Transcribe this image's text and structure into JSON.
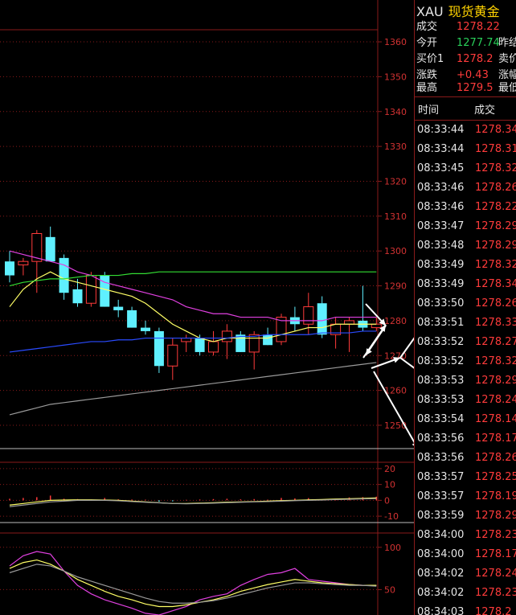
{
  "quote": {
    "code": "XAU",
    "name": "现货黄金",
    "rows": [
      {
        "label": "成交",
        "value": "1278.22",
        "color": "red"
      },
      {
        "label": "今开",
        "value": "1277.74",
        "color": "green",
        "label2": "昨结"
      },
      {
        "label": "买价1",
        "value": "1278.2",
        "color": "red",
        "label2": "卖价"
      },
      {
        "label": "涨跌",
        "value": "+0.43",
        "color": "red",
        "label2": "涨幅"
      },
      {
        "label": "最高",
        "value": "1279.5",
        "color": "red",
        "label2": "最低"
      }
    ]
  },
  "ticks": {
    "headers": [
      "时间",
      "成交"
    ],
    "rows": [
      {
        "time": "08:33:44",
        "price": "1278.34"
      },
      {
        "time": "08:33:44",
        "price": "1278.31"
      },
      {
        "time": "08:33:45",
        "price": "1278.32"
      },
      {
        "time": "08:33:46",
        "price": "1278.26"
      },
      {
        "time": "08:33:46",
        "price": "1278.22"
      },
      {
        "time": "08:33:47",
        "price": "1278.29"
      },
      {
        "time": "08:33:48",
        "price": "1278.29"
      },
      {
        "time": "08:33:49",
        "price": "1278.32"
      },
      {
        "time": "08:33:49",
        "price": "1278.34"
      },
      {
        "time": "08:33:50",
        "price": "1278.26"
      },
      {
        "time": "08:33:51",
        "price": "1278.33"
      },
      {
        "time": "08:33:52",
        "price": "1278.27"
      },
      {
        "time": "08:33:52",
        "price": "1278.32"
      },
      {
        "time": "08:33:53",
        "price": "1278.29"
      },
      {
        "time": "08:33:53",
        "price": "1278.24"
      },
      {
        "time": "08:33:54",
        "price": "1278.14"
      },
      {
        "time": "08:33:56",
        "price": "1278.17"
      },
      {
        "time": "08:33:56",
        "price": "1278.26"
      },
      {
        "time": "08:33:57",
        "price": "1278.25"
      },
      {
        "time": "08:33:57",
        "price": "1278.19"
      },
      {
        "time": "08:33:59",
        "price": "1278.29"
      },
      {
        "time": "08:34:00",
        "price": "1278.23"
      },
      {
        "time": "08:34:00",
        "price": "1278.17"
      },
      {
        "time": "08:34:02",
        "price": "1278.24"
      },
      {
        "time": "08:34:02",
        "price": "1278.23"
      },
      {
        "time": "08:34:03",
        "price": "1278.2"
      }
    ]
  },
  "colors": {
    "up": "#ff3b3b",
    "down": "#5ff0ff",
    "grid": "#8a1a1a",
    "axis_text": "#d23232",
    "ma_yellow": "#ffff66",
    "ma_magenta": "#e040e0",
    "ma_blue": "#2a4bff",
    "ma_green": "#33dd33",
    "ma_gray": "#9a9a9a"
  },
  "chart_data": [
    {
      "type": "candlestick",
      "yticks": [
        1250,
        1260,
        1270,
        1280,
        1290,
        1300,
        1310,
        1320,
        1330,
        1340,
        1350,
        1360
      ],
      "ylim": [
        1244,
        1372
      ],
      "candles": [
        {
          "o": 1297,
          "h": 1300,
          "l": 1291,
          "c": 1293
        },
        {
          "o": 1296,
          "h": 1298,
          "l": 1293,
          "c": 1297
        },
        {
          "o": 1297,
          "h": 1306,
          "l": 1288,
          "c": 1305
        },
        {
          "o": 1304,
          "h": 1307,
          "l": 1297,
          "c": 1297
        },
        {
          "o": 1298,
          "h": 1299,
          "l": 1286,
          "c": 1288
        },
        {
          "o": 1289,
          "h": 1292,
          "l": 1284,
          "c": 1285
        },
        {
          "o": 1285,
          "h": 1294,
          "l": 1284,
          "c": 1293
        },
        {
          "o": 1293,
          "h": 1294,
          "l": 1284,
          "c": 1284
        },
        {
          "o": 1284,
          "h": 1286,
          "l": 1281,
          "c": 1283
        },
        {
          "o": 1283,
          "h": 1284,
          "l": 1278,
          "c": 1278
        },
        {
          "o": 1278,
          "h": 1280,
          "l": 1276,
          "c": 1277
        },
        {
          "o": 1277,
          "h": 1278,
          "l": 1265,
          "c": 1267
        },
        {
          "o": 1267,
          "h": 1275,
          "l": 1263,
          "c": 1273
        },
        {
          "o": 1274,
          "h": 1276,
          "l": 1271,
          "c": 1275
        },
        {
          "o": 1275,
          "h": 1276,
          "l": 1270,
          "c": 1271
        },
        {
          "o": 1271,
          "h": 1277,
          "l": 1270,
          "c": 1274
        },
        {
          "o": 1274,
          "h": 1279,
          "l": 1269,
          "c": 1277
        },
        {
          "o": 1276,
          "h": 1277,
          "l": 1271,
          "c": 1271
        },
        {
          "o": 1271,
          "h": 1277,
          "l": 1266,
          "c": 1276
        },
        {
          "o": 1276,
          "h": 1278,
          "l": 1273,
          "c": 1273
        },
        {
          "o": 1274,
          "h": 1282,
          "l": 1273,
          "c": 1281
        },
        {
          "o": 1281,
          "h": 1284,
          "l": 1277,
          "c": 1279
        },
        {
          "o": 1279,
          "h": 1288,
          "l": 1276,
          "c": 1284
        },
        {
          "o": 1285,
          "h": 1287,
          "l": 1275,
          "c": 1276
        },
        {
          "o": 1276,
          "h": 1281,
          "l": 1272,
          "c": 1279
        },
        {
          "o": 1279,
          "h": 1281,
          "l": 1271,
          "c": 1280
        },
        {
          "o": 1280,
          "h": 1290,
          "l": 1277,
          "c": 1278
        },
        {
          "o": 1278,
          "h": 1281,
          "l": 1277,
          "c": 1279
        }
      ],
      "series": [
        {
          "color": "ma_magenta",
          "values": [
            1300,
            1299,
            1298,
            1297,
            1296,
            1294,
            1293,
            1291,
            1290,
            1289,
            1288,
            1287,
            1286,
            1284,
            1283,
            1282,
            1282,
            1281,
            1281,
            1281,
            1280,
            1280,
            1280,
            1280,
            1281,
            1281,
            1281,
            1281
          ]
        },
        {
          "color": "ma_yellow",
          "values": [
            1284,
            1289,
            1292,
            1294,
            1292,
            1291,
            1290,
            1289,
            1288,
            1287,
            1285,
            1282,
            1279,
            1277,
            1275,
            1274,
            1275,
            1275,
            1275,
            1275,
            1276,
            1277,
            1278,
            1278,
            1279,
            1279,
            1279,
            1279
          ]
        },
        {
          "color": "ma_green",
          "values": [
            1290,
            1291,
            1291.5,
            1292,
            1292,
            1292.5,
            1293,
            1293,
            1293,
            1293.5,
            1293.5,
            1294,
            1294,
            1294,
            1294,
            1294,
            1294,
            1294,
            1294,
            1294,
            1294,
            1294,
            1294,
            1294,
            1294,
            1294,
            1294,
            1294
          ]
        },
        {
          "color": "ma_blue",
          "values": [
            1271,
            1271.5,
            1272,
            1272.5,
            1273,
            1273.5,
            1274,
            1274,
            1274.5,
            1274.5,
            1275,
            1275,
            1275,
            1275,
            1275,
            1275,
            1275,
            1275.5,
            1275.5,
            1276,
            1276,
            1276,
            1276,
            1276.5,
            1276.5,
            1276.5,
            1277,
            1277
          ]
        },
        {
          "color": "ma_gray",
          "values": [
            1253,
            1254,
            1255,
            1256,
            1256.5,
            1257,
            1257.5,
            1258,
            1258.5,
            1259,
            1259.5,
            1260,
            1260.5,
            1261,
            1261.5,
            1262,
            1262.5,
            1263,
            1263.5,
            1264,
            1264.5,
            1265,
            1265.5,
            1266,
            1266.5,
            1267,
            1267.5,
            1268
          ]
        }
      ]
    },
    {
      "type": "bar",
      "yticks": [
        20,
        10,
        0,
        -10
      ],
      "ylim": [
        -13,
        23
      ],
      "values": [
        1,
        1.5,
        2,
        3,
        1,
        0.8,
        0.5,
        1.5,
        0.6,
        0.5,
        0.4,
        -0.8,
        -0.6,
        0.3,
        0.5,
        0.8,
        1,
        0.6,
        0.8,
        0.4,
        1.5,
        1.2,
        1.4,
        0.7,
        0.9,
        1.8,
        2,
        2.3
      ],
      "series": [
        {
          "color": "ma_yellow",
          "values": [
            -3,
            -2,
            -1,
            0,
            0.2,
            0.3,
            0.3,
            0.2,
            0,
            -0.5,
            -1,
            -1.5,
            -2,
            -2,
            -1.8,
            -1.5,
            -1.2,
            -1,
            -0.8,
            -0.5,
            -0.2,
            0,
            0.3,
            0.5,
            0.8,
            1,
            1.2,
            1.5
          ]
        },
        {
          "color": "ma_gray",
          "values": [
            -4,
            -3,
            -2,
            -1,
            -0.5,
            0,
            0,
            0,
            -0.3,
            -0.8,
            -1.2,
            -1.6,
            -2,
            -2.2,
            -2,
            -1.8,
            -1.5,
            -1.2,
            -1,
            -0.8,
            -0.5,
            -0.2,
            0,
            0.2,
            0.5,
            0.7,
            0.9,
            1.1
          ]
        }
      ]
    },
    {
      "type": "line",
      "yticks": [
        100,
        50
      ],
      "ylim": [
        20,
        115
      ],
      "series": [
        {
          "color": "ma_magenta",
          "values": [
            78,
            90,
            95,
            92,
            72,
            55,
            45,
            38,
            33,
            28,
            22,
            20,
            25,
            30,
            38,
            42,
            45,
            55,
            62,
            68,
            70,
            75,
            62,
            60,
            58,
            56,
            55,
            55
          ]
        },
        {
          "color": "ma_yellow",
          "values": [
            75,
            82,
            85,
            80,
            72,
            62,
            55,
            48,
            42,
            38,
            33,
            30,
            30,
            32,
            35,
            38,
            42,
            48,
            52,
            56,
            59,
            62,
            60,
            58,
            57,
            56,
            55,
            55
          ]
        },
        {
          "color": "ma_gray",
          "values": [
            70,
            75,
            80,
            78,
            72,
            65,
            60,
            55,
            50,
            45,
            40,
            36,
            34,
            34,
            35,
            37,
            40,
            44,
            48,
            52,
            55,
            58,
            58,
            57,
            56,
            55,
            55,
            54
          ]
        }
      ]
    }
  ]
}
